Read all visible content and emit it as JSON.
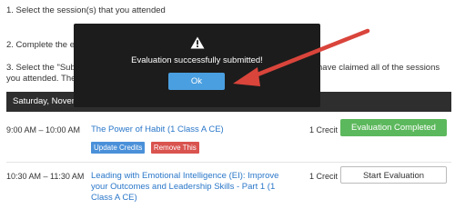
{
  "instructions": {
    "step1": "1. Select the session(s) that you attended",
    "step2": "2. Complete the ev",
    "step3_line1": "3. Select the \"Subr",
    "step3_line2": "you attended. The",
    "step3_right": "have claimed all of the sessions"
  },
  "day_header": "Saturday, Novem",
  "sessions": [
    {
      "time": "9:00 AM – 10:00 AM",
      "title": "The Power of Habit (1 Class A CE)",
      "credit": "1 Crecit",
      "actions": [
        "Update Credits",
        "Remove This"
      ],
      "status_button": "Evaluation Completed"
    },
    {
      "time": "10:30 AM – 11:30 AM",
      "title": "Leading with Emotional Intelligence (EI): Improve your Outcomes and Leadership Skills - Part 1 (1 Class A CE)",
      "credit": "1 Crecit",
      "status_button": "Start Evaluation"
    }
  ],
  "modal": {
    "icon": "warning-icon",
    "message": "Evaluation successfully submitted!",
    "ok_label": "Ok"
  },
  "colors": {
    "link": "#2a77c9",
    "completed": "#5cb85c",
    "remove": "#d9534f",
    "ok": "#4a9fe0",
    "annotation_arrow": "#d9443b"
  }
}
